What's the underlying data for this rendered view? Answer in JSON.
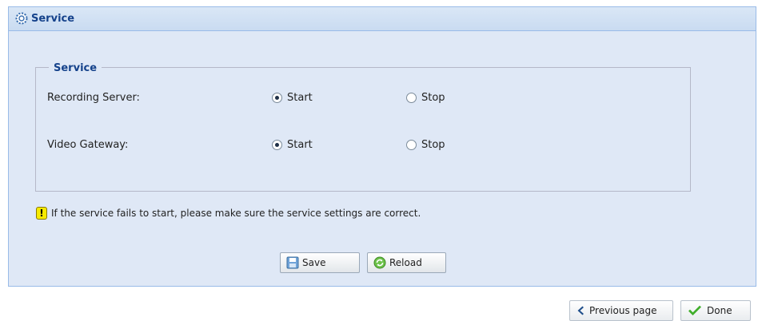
{
  "panel": {
    "title": "Service",
    "icon": "gear-icon"
  },
  "service_group": {
    "legend": "Service",
    "rows": [
      {
        "label": "Recording Server:",
        "start_label": "Start",
        "stop_label": "Stop",
        "selected": "Start"
      },
      {
        "label": "Video Gateway:",
        "start_label": "Start",
        "stop_label": "Stop",
        "selected": "Start"
      }
    ]
  },
  "warning": {
    "text": "If the service fails to start, please make sure the service settings are correct.",
    "icon_glyph": "!"
  },
  "actions": {
    "save_label": "Save",
    "reload_label": "Reload"
  },
  "footer": {
    "previous_label": "Previous page",
    "done_label": "Done"
  },
  "colors": {
    "panel_bg": "#dfe8f6",
    "header_text": "#15428b",
    "border": "#99bbe8",
    "warning_yellow": "#f6ea00"
  }
}
